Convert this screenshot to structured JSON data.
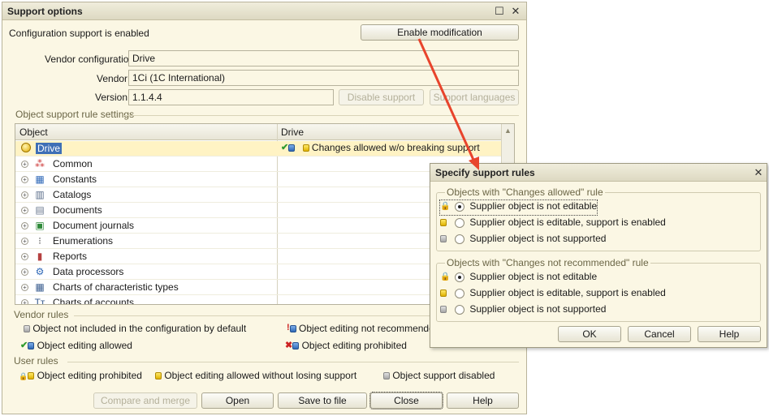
{
  "main": {
    "title": "Support options",
    "status_text": "Configuration support is enabled",
    "enable_btn": "Enable modification",
    "vendor_config_label": "Vendor configuration:",
    "vendor_config_value": "Drive",
    "vendor_label": "Vendor:",
    "vendor_value": "1Ci (1C International)",
    "version_label": "Version:",
    "version_value": "1.1.4.4",
    "disable_support_btn": "Disable support",
    "support_languages_btn": "Support languages",
    "rule_settings_title": "Object support rule settings",
    "col_object": "Object",
    "col_drive": "Drive",
    "rows": [
      {
        "label": "Drive",
        "icon": "configuration-icon",
        "rule": "Changes allowed w/o breaking support"
      },
      {
        "label": "Common",
        "icon": "common-icon"
      },
      {
        "label": "Constants",
        "icon": "constants-icon"
      },
      {
        "label": "Catalogs",
        "icon": "catalogs-icon"
      },
      {
        "label": "Documents",
        "icon": "documents-icon"
      },
      {
        "label": "Document journals",
        "icon": "document-journals-icon"
      },
      {
        "label": "Enumerations",
        "icon": "enumerations-icon"
      },
      {
        "label": "Reports",
        "icon": "reports-icon"
      },
      {
        "label": "Data processors",
        "icon": "data-processors-icon"
      },
      {
        "label": "Charts of characteristic types",
        "icon": "charts-icon"
      },
      {
        "label": "Charts of accounts",
        "icon": "charts-of-accounts-icon"
      }
    ],
    "vendor_rules_title": "Vendor rules",
    "vendor_rules": {
      "not_included": "Object not included in the configuration by default",
      "not_recommended": "Object editing not recommended",
      "allowed": "Object editing allowed",
      "prohibited": "Object editing prohibited"
    },
    "user_rules_title": "User rules",
    "user_rules": {
      "prohibited": "Object editing prohibited",
      "allowed_no_loss": "Object editing allowed without losing support",
      "disabled": "Object support disabled"
    },
    "buttons": {
      "compare": "Compare and merge",
      "open": "Open",
      "save": "Save to file",
      "close": "Close",
      "help": "Help"
    }
  },
  "dialog": {
    "title": "Specify support rules",
    "group1_title": "Objects with \"Changes allowed\" rule",
    "group1_options": [
      "Supplier object is not editable",
      "Supplier object is editable, support is enabled",
      "Supplier object is not supported"
    ],
    "group2_title": "Objects with \"Changes not recommended\" rule",
    "group2_options": [
      "Supplier object is not editable",
      "Supplier object is editable, support is enabled",
      "Supplier object is not supported"
    ],
    "ok": "OK",
    "cancel": "Cancel",
    "help": "Help"
  },
  "colors": {
    "panel": "#fbf7e4",
    "selection": "#3e6fb6",
    "arrow": "#e8442c"
  }
}
